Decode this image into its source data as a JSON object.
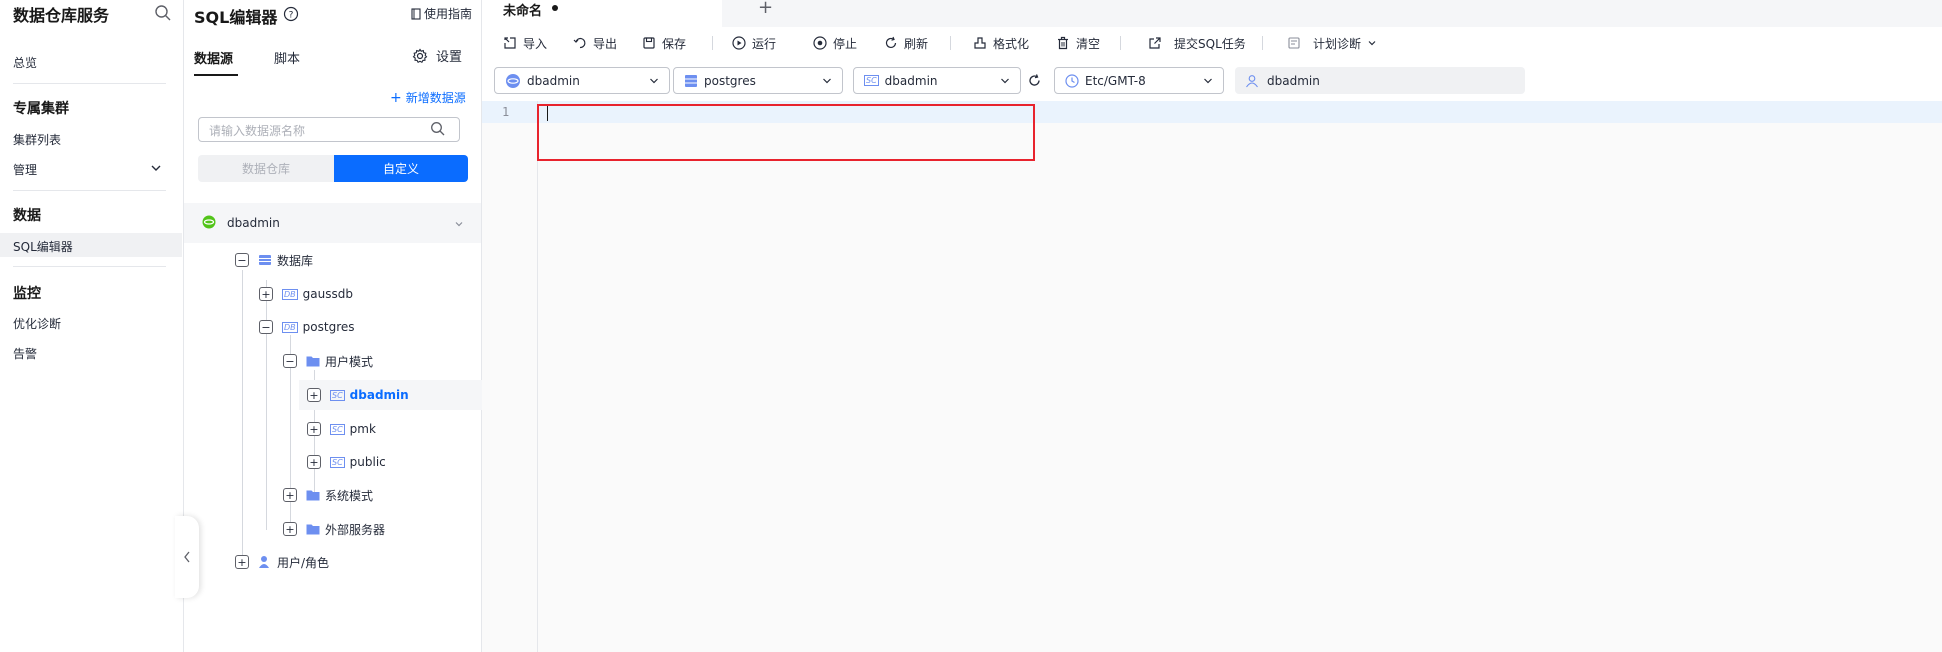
{
  "nav": {
    "title": "数据仓库服务",
    "overview": "总览",
    "group_cluster": "专属集群",
    "cluster_list": "集群列表",
    "manage": "管理",
    "group_data": "数据",
    "sql_editor": "SQL编辑器",
    "group_monitor": "监控",
    "optimize": "优化诊断",
    "alarm": "告警"
  },
  "sidebar": {
    "title": "SQL编辑器",
    "guide": "使用指南",
    "tabs": [
      "数据源",
      "脚本"
    ],
    "settings": "设置",
    "add_datasource": "新增数据源",
    "search_placeholder": "请输入数据源名称",
    "segment_off": "数据仓库",
    "segment_on": "自定义",
    "tree": {
      "root": "dbadmin",
      "databases": "数据库",
      "db1": "gaussdb",
      "db2": "postgres",
      "user_schemas": "用户模式",
      "schema1": "dbadmin",
      "schema2": "pmk",
      "schema3": "public",
      "system_schemas": "系统模式",
      "foreign_servers": "外部服务器",
      "users_roles": "用户/角色"
    }
  },
  "editor": {
    "tab_name": "未命名",
    "add_tab": "+",
    "toolbar": {
      "import": "导入",
      "export": "导出",
      "save": "保存",
      "run": "运行",
      "stop": "停止",
      "refresh": "刷新",
      "format": "格式化",
      "clear": "清空",
      "submit": "提交SQL任务",
      "plan": "计划诊断"
    },
    "selects": {
      "datasource": "dbadmin",
      "database": "postgres",
      "schema": "dbadmin",
      "timezone": "Etc/GMT-8"
    },
    "user": "dbadmin",
    "line_number": "1"
  },
  "colors": {
    "accent": "#0a6cff",
    "highlight_border": "#e8232d",
    "current_line": "#eaf3fd"
  }
}
